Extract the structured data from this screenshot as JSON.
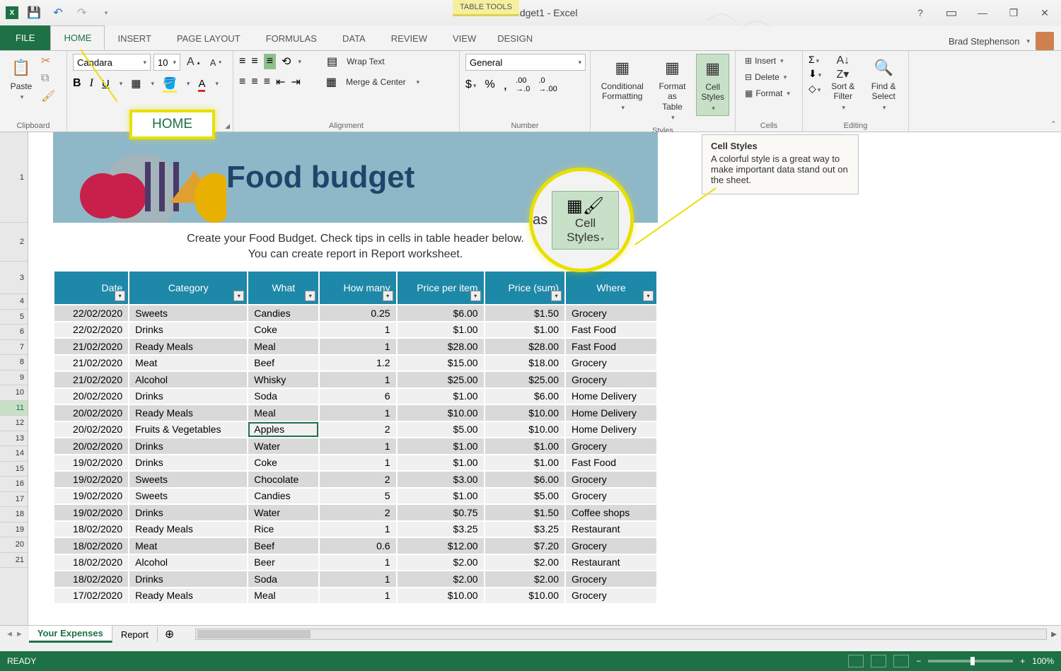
{
  "title_bar": {
    "document_title": "Food budget1 - Excel",
    "table_tools_label": "TABLE TOOLS"
  },
  "tabs": {
    "file": "FILE",
    "home": "HOME",
    "insert": "INSERT",
    "page_layout": "PAGE LAYOUT",
    "formulas": "FORMULAS",
    "data": "DATA",
    "review": "REVIEW",
    "view": "VIEW",
    "design": "DESIGN"
  },
  "user": {
    "name": "Brad Stephenson"
  },
  "ribbon": {
    "clipboard": {
      "label": "Clipboard",
      "paste": "Paste"
    },
    "font": {
      "name": "Candara",
      "size": "10"
    },
    "alignment": {
      "label": "Alignment",
      "wrap_text": "Wrap Text",
      "merge_center": "Merge & Center"
    },
    "number": {
      "label": "Number",
      "format": "General"
    },
    "styles": {
      "label": "Styles",
      "conditional": "Conditional Formatting",
      "format_as": "Format as Table",
      "cell_styles": "Cell Styles"
    },
    "cells": {
      "label": "Cells",
      "insert": "Insert",
      "delete": "Delete",
      "format": "Format"
    },
    "editing": {
      "label": "Editing",
      "sort_filter": "Sort & Filter",
      "find_select": "Find & Select"
    }
  },
  "callouts": {
    "home_highlight": "HOME",
    "cell_styles_big": "Cell Styles",
    "as_label": "as",
    "tooltip_title": "Cell Styles",
    "tooltip_body": "A colorful style is a great way to make important data stand out on the sheet."
  },
  "sheet": {
    "banner_title": "Food budget",
    "subtitle_line1": "Create your Food Budget. Check tips in cells in table header below.",
    "subtitle_line2": "You can create report in Report worksheet.",
    "headers": {
      "date": "Date",
      "category": "Category",
      "what": "What",
      "how_many": "How many",
      "price_per_item": "Price per item",
      "price_sum": "Price (sum)",
      "where": "Where"
    },
    "rows": [
      {
        "date": "22/02/2020",
        "category": "Sweets",
        "what": "Candies",
        "qty": "0.25",
        "price": "$6.00",
        "sum": "$1.50",
        "where": "Grocery"
      },
      {
        "date": "22/02/2020",
        "category": "Drinks",
        "what": "Coke",
        "qty": "1",
        "price": "$1.00",
        "sum": "$1.00",
        "where": "Fast Food"
      },
      {
        "date": "21/02/2020",
        "category": "Ready Meals",
        "what": "Meal",
        "qty": "1",
        "price": "$28.00",
        "sum": "$28.00",
        "where": "Fast Food"
      },
      {
        "date": "21/02/2020",
        "category": "Meat",
        "what": "Beef",
        "qty": "1.2",
        "price": "$15.00",
        "sum": "$18.00",
        "where": "Grocery"
      },
      {
        "date": "21/02/2020",
        "category": "Alcohol",
        "what": "Whisky",
        "qty": "1",
        "price": "$25.00",
        "sum": "$25.00",
        "where": "Grocery"
      },
      {
        "date": "20/02/2020",
        "category": "Drinks",
        "what": "Soda",
        "qty": "6",
        "price": "$1.00",
        "sum": "$6.00",
        "where": "Home Delivery"
      },
      {
        "date": "20/02/2020",
        "category": "Ready Meals",
        "what": "Meal",
        "qty": "1",
        "price": "$10.00",
        "sum": "$10.00",
        "where": "Home Delivery"
      },
      {
        "date": "20/02/2020",
        "category": "Fruits & Vegetables",
        "what": "Apples",
        "qty": "2",
        "price": "$5.00",
        "sum": "$10.00",
        "where": "Home Delivery"
      },
      {
        "date": "20/02/2020",
        "category": "Drinks",
        "what": "Water",
        "qty": "1",
        "price": "$1.00",
        "sum": "$1.00",
        "where": "Grocery"
      },
      {
        "date": "19/02/2020",
        "category": "Drinks",
        "what": "Coke",
        "qty": "1",
        "price": "$1.00",
        "sum": "$1.00",
        "where": "Fast Food"
      },
      {
        "date": "19/02/2020",
        "category": "Sweets",
        "what": "Chocolate",
        "qty": "2",
        "price": "$3.00",
        "sum": "$6.00",
        "where": "Grocery"
      },
      {
        "date": "19/02/2020",
        "category": "Sweets",
        "what": "Candies",
        "qty": "5",
        "price": "$1.00",
        "sum": "$5.00",
        "where": "Grocery"
      },
      {
        "date": "19/02/2020",
        "category": "Drinks",
        "what": "Water",
        "qty": "2",
        "price": "$0.75",
        "sum": "$1.50",
        "where": "Coffee shops"
      },
      {
        "date": "18/02/2020",
        "category": "Ready Meals",
        "what": "Rice",
        "qty": "1",
        "price": "$3.25",
        "sum": "$3.25",
        "where": "Restaurant"
      },
      {
        "date": "18/02/2020",
        "category": "Meat",
        "what": "Beef",
        "qty": "0.6",
        "price": "$12.00",
        "sum": "$7.20",
        "where": "Grocery"
      },
      {
        "date": "18/02/2020",
        "category": "Alcohol",
        "what": "Beer",
        "qty": "1",
        "price": "$2.00",
        "sum": "$2.00",
        "where": "Restaurant"
      },
      {
        "date": "18/02/2020",
        "category": "Drinks",
        "what": "Soda",
        "qty": "1",
        "price": "$2.00",
        "sum": "$2.00",
        "where": "Grocery"
      },
      {
        "date": "17/02/2020",
        "category": "Ready Meals",
        "what": "Meal",
        "qty": "1",
        "price": "$10.00",
        "sum": "$10.00",
        "where": "Grocery"
      }
    ]
  },
  "sheet_tabs": {
    "your_expenses": "Your Expenses",
    "report": "Report"
  },
  "status": {
    "ready": "READY",
    "zoom": "100%"
  }
}
